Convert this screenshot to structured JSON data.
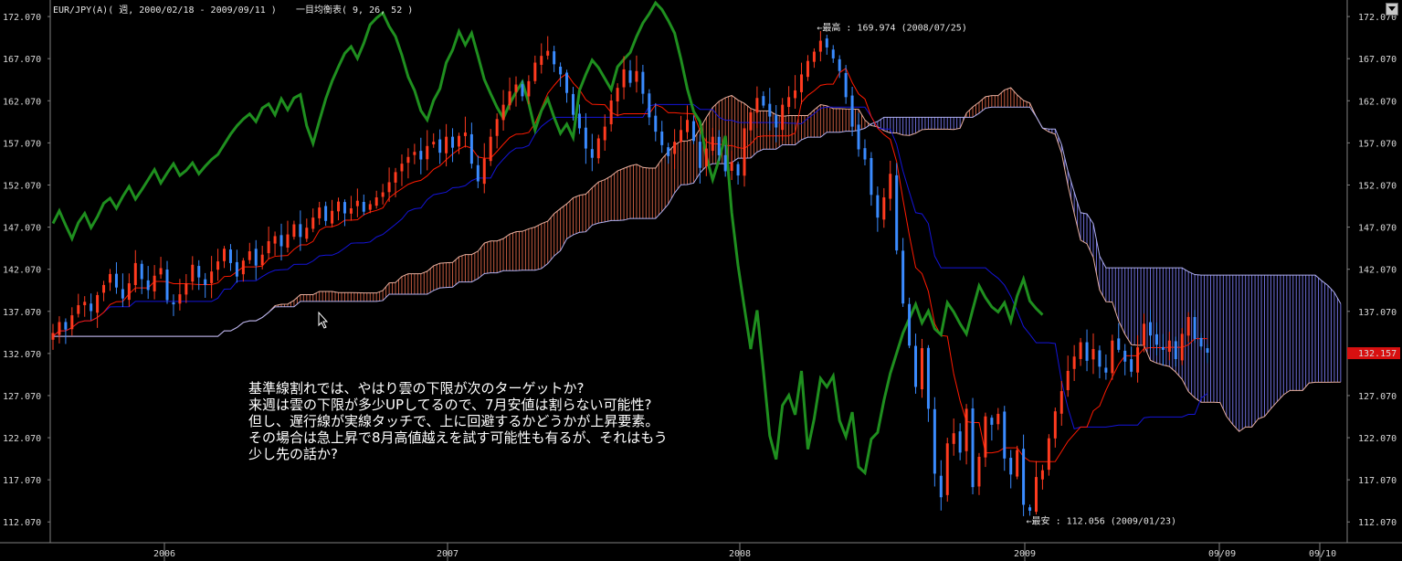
{
  "header": {
    "title": "EUR/JPY(A)( 週, 2000/02/18 - 2009/09/11 )",
    "indicator": "一目均衡表( 9, 26, 52 )"
  },
  "colors": {
    "background": "#000000",
    "axis": "#808080",
    "candle_up": "#ff3b1f",
    "candle_down": "#3a8bff",
    "tenkan": "#ff1a00",
    "kijun": "#1414d8",
    "chikou": "#1f8f1f",
    "cloud_bull": "#c25a3f",
    "cloud_bear": "#6c6cd6",
    "price_tag": "#d81010"
  },
  "chart_data": {
    "type": "candlestick",
    "title": "EUR/JPY(A)( 週, 2000/02/18 - 2009/09/11 )",
    "indicator": "一目均衡表( 9, 26, 52 )",
    "y_ticks": [
      "172.070",
      "167.070",
      "162.070",
      "157.070",
      "152.070",
      "147.070",
      "142.070",
      "137.070",
      "132.070",
      "127.070",
      "122.070",
      "117.070",
      "112.070"
    ],
    "ylim": [
      109.6,
      173.6
    ],
    "x_ticks": [
      "2006",
      "2007",
      "2008",
      "2009",
      "09/09",
      "09/10"
    ],
    "current_price": "132.157",
    "annotations": [
      {
        "text": "←最高 : 169.974 (2008/07/25)",
        "date": "2008/07/25",
        "value": 169.974
      },
      {
        "text": "←最安 : 112.056 (2009/01/23)",
        "date": "2009/01/23",
        "value": 112.056
      }
    ],
    "note_lines": [
      "基準線割れでは、やはり雲の下限が次のターゲットか?",
      "来週は雲の下限が多少UPしてるので、7月安値は割らない可能性?",
      "但し、遅行線が実線タッチで、上に回避するかどうかが上昇要素。",
      "その場合は急上昇で8月高値越えを試す可能性も有るが、それはもう",
      "少し先の話か?"
    ],
    "candles_close": [
      134.5,
      135.8,
      134.9,
      136.6,
      137.8,
      138.2,
      137.1,
      139.0,
      140.2,
      141.5,
      139.9,
      138.6,
      140.4,
      142.8,
      140.9,
      139.6,
      141.3,
      142.2,
      138.4,
      137.9,
      139.1,
      140.4,
      142.6,
      141.1,
      140.2,
      141.8,
      143.0,
      144.5,
      142.8,
      141.2,
      143.1,
      144.2,
      142.5,
      143.8,
      145.4,
      146.0,
      144.8,
      146.2,
      147.4,
      145.9,
      147.0,
      148.2,
      149.4,
      147.8,
      149.0,
      150.1,
      148.7,
      149.3,
      150.2,
      148.9,
      149.8,
      150.6,
      151.2,
      152.4,
      153.6,
      154.6,
      155.4,
      156.0,
      155.1,
      156.7,
      157.2,
      155.9,
      157.8,
      156.5,
      157.9,
      158.3,
      154.6,
      152.5,
      155.2,
      157.8,
      159.9,
      161.6,
      163.2,
      164.0,
      162.6,
      164.4,
      166.6,
      167.4,
      168.0,
      166.4,
      165.2,
      163.0,
      160.4,
      158.8,
      156.4,
      155.3,
      157.6,
      159.0,
      162.1,
      163.6,
      165.8,
      164.2,
      165.6,
      162.9,
      160.1,
      158.4,
      156.8,
      155.5,
      157.2,
      158.6,
      159.8,
      157.3,
      154.1,
      156.4,
      157.8,
      155.6,
      153.7,
      154.8,
      153.2,
      158.8,
      160.7,
      162.4,
      161.5,
      160.2,
      158.9,
      161.6,
      162.5,
      163.3,
      165.2,
      166.8,
      167.9,
      169.2,
      168.4,
      167.1,
      165.6,
      162.5,
      159.0,
      156.3,
      155.1,
      150.9,
      148.2,
      150.6,
      153.4,
      144.3,
      138.0,
      133.0,
      128.1,
      132.7,
      125.5,
      117.8,
      115.0,
      121.4,
      122.6,
      120.3,
      125.5,
      116.2,
      119.8,
      124.6,
      123.6,
      124.9,
      119.6,
      117.7,
      120.6,
      114.1,
      113.4,
      117.4,
      118.2,
      122.0,
      125.2,
      127.6,
      130.0,
      131.7,
      133.4,
      131.2,
      132.6,
      130.5,
      129.8,
      133.6,
      132.5,
      131.1,
      129.9,
      132.8,
      135.6,
      134.2,
      133.1,
      132.5,
      133.6,
      131.4,
      134.4,
      136.4,
      133.8,
      132.9,
      132.16
    ]
  }
}
